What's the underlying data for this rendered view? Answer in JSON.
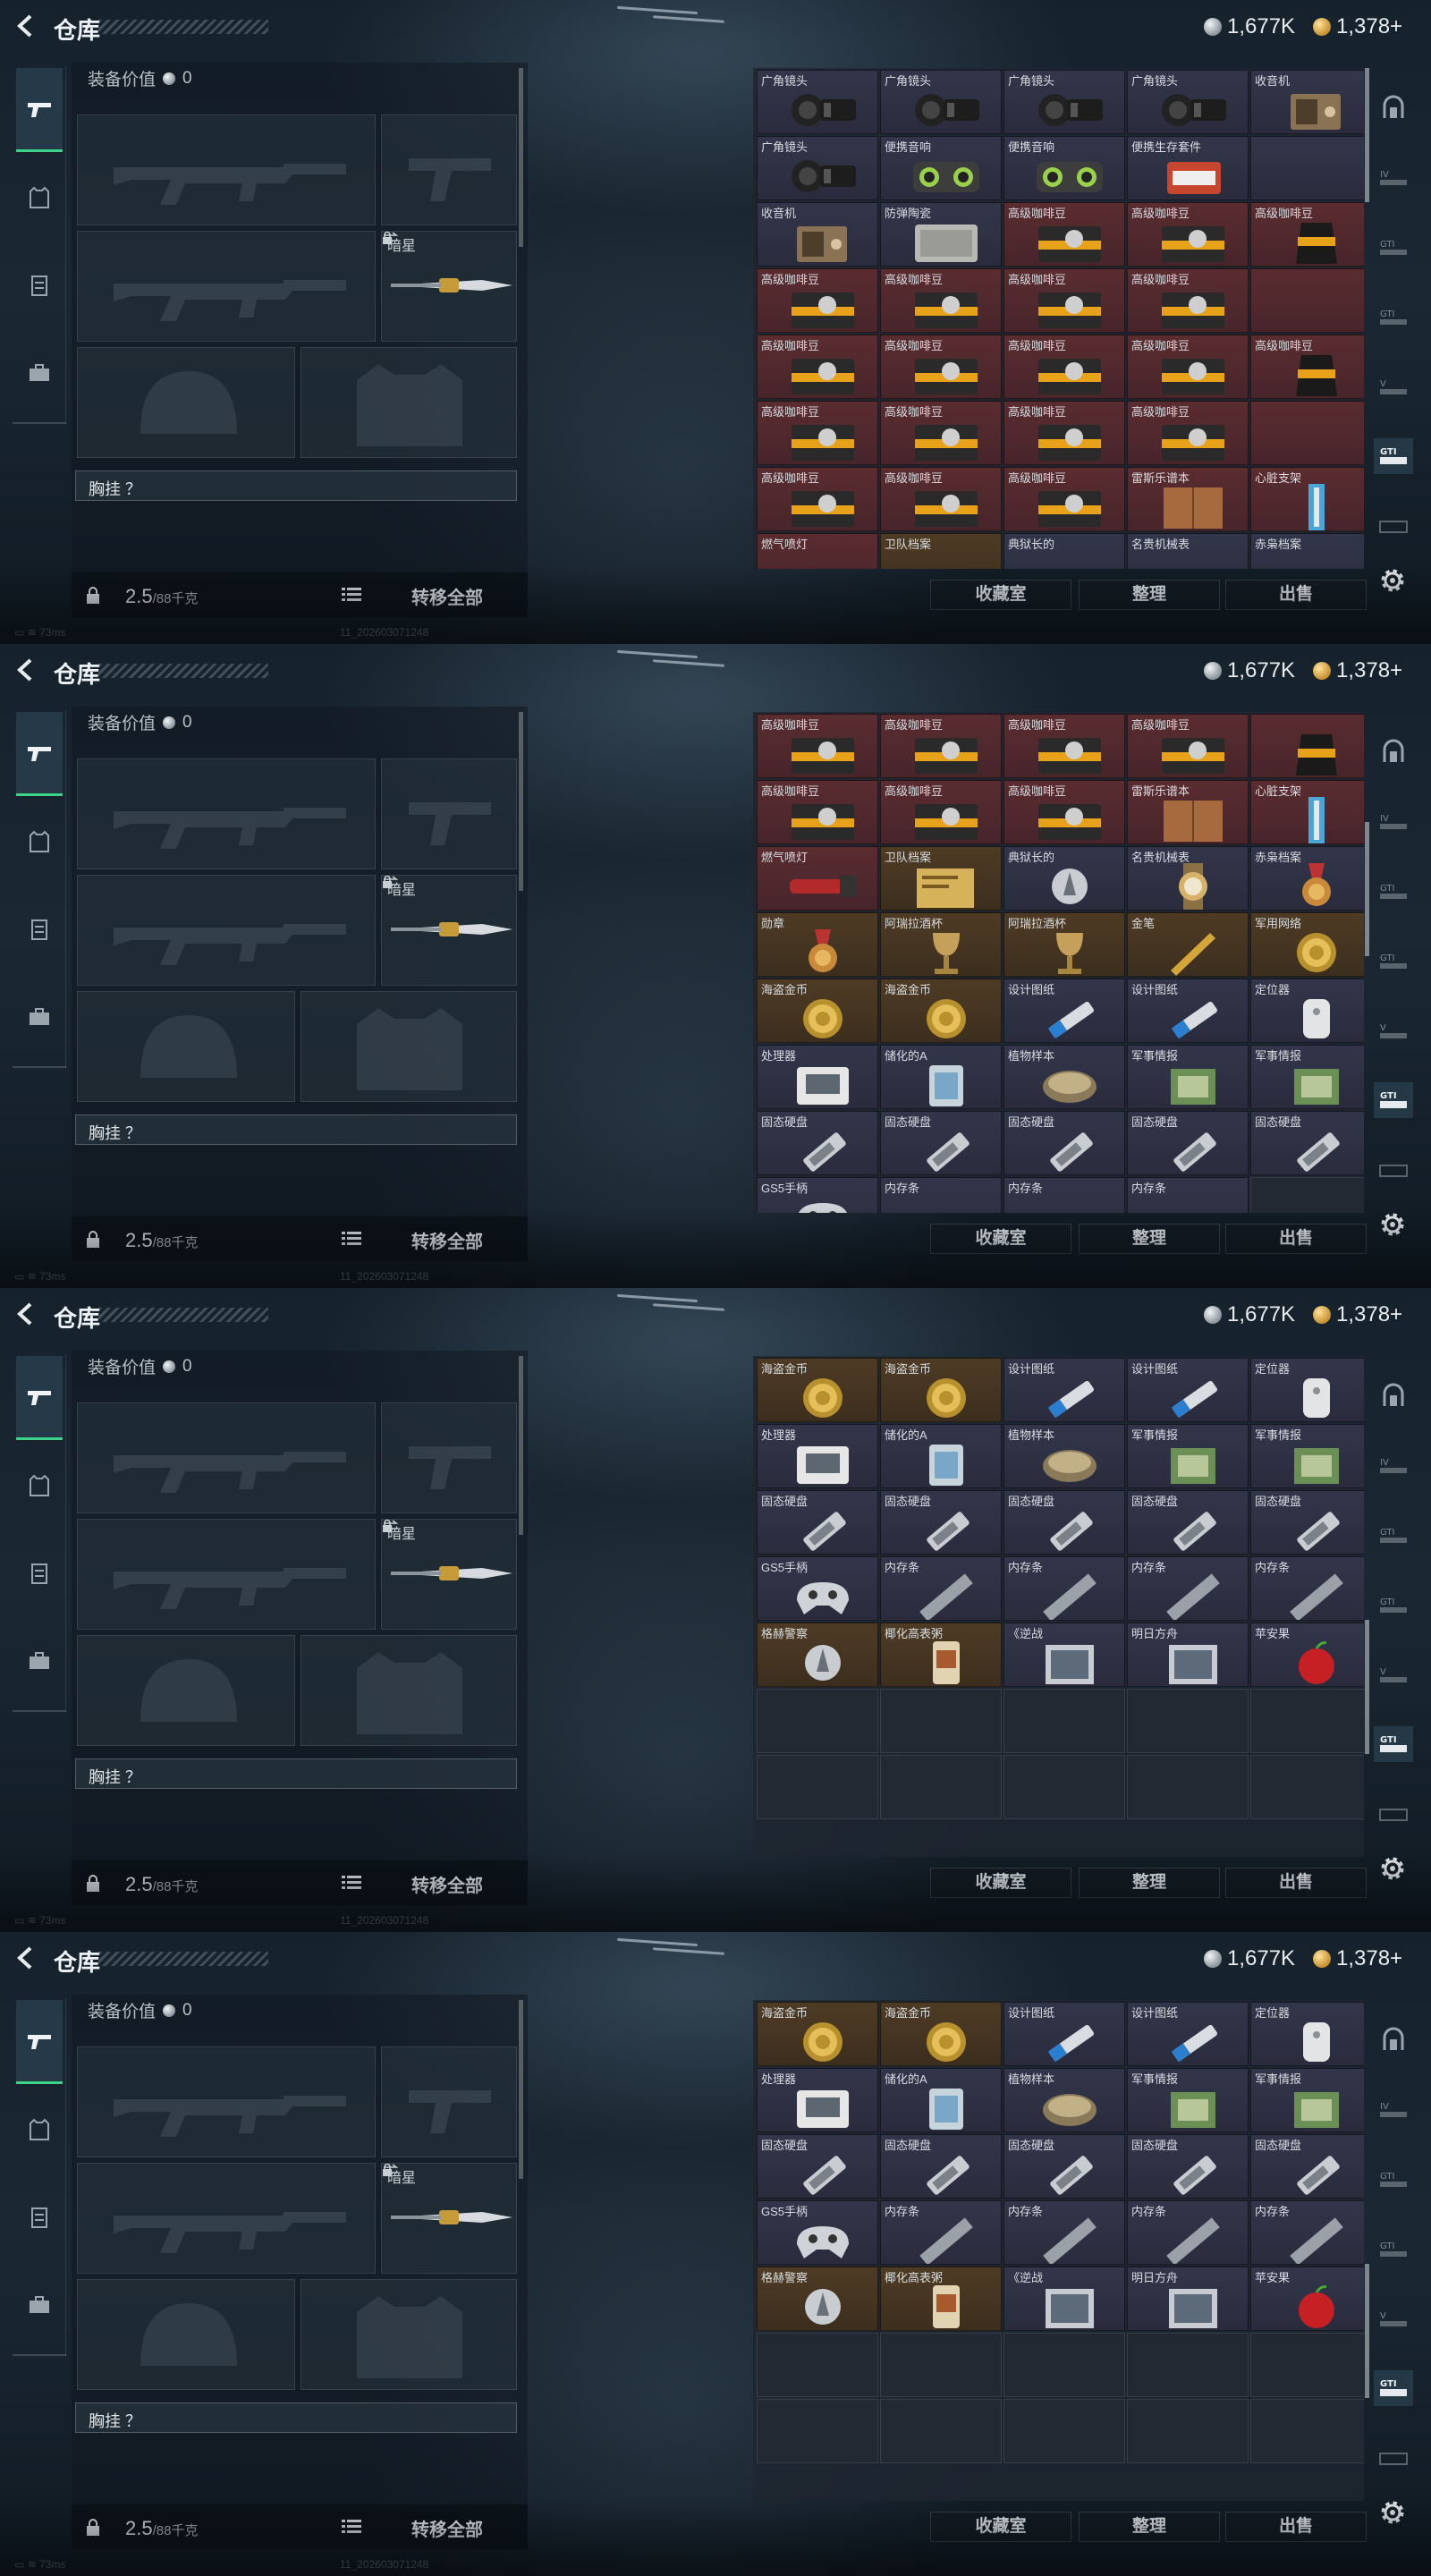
{
  "header": {
    "title": "仓库",
    "silver_amount": "1,677K",
    "gold_amount": "1,378+"
  },
  "equipment": {
    "value_label": "装备价值",
    "value": "0",
    "secondary_slot_label": "暗星",
    "chest_label": "胸挂 ？",
    "weight": "2.5",
    "capacity": "/88千克",
    "transfer_all": "转移全部"
  },
  "actions": {
    "collection": "收藏室",
    "sort": "整理",
    "sell": "出售"
  },
  "status": {
    "ping": "73ms",
    "build": "11_202603071248"
  },
  "colors": {
    "accent": "#40d38a",
    "red_rarity": "#5a2c30",
    "gold_rarity": "#4e3b24",
    "blue_rarity": "#33354a"
  },
  "frames": [
    {
      "scroll_fraction": 0.0,
      "rows": [
        [
          {
            "n": "广角镜头",
            "c": "blue",
            "i": "lens"
          },
          {
            "n": "广角镜头",
            "c": "blue",
            "i": "lens"
          },
          {
            "n": "广角镜头",
            "c": "blue",
            "i": "lens"
          },
          {
            "n": "广角镜头",
            "c": "blue",
            "i": "lens"
          },
          {
            "n": "收音机",
            "c": "blue",
            "i": "radio"
          }
        ],
        [
          {
            "n": "广角镜头",
            "c": "blue",
            "i": "lens"
          },
          {
            "n": "便携音响",
            "c": "blue",
            "i": "speaker"
          },
          {
            "n": "便携音响",
            "c": "blue",
            "i": "speaker"
          },
          {
            "n": "便携生存套件",
            "c": "blue",
            "i": "kit"
          },
          {
            "n": "",
            "c": "blue",
            "i": ""
          }
        ],
        [
          {
            "n": "收音机",
            "c": "blue",
            "i": "radio"
          },
          {
            "n": "防弹陶瓷",
            "c": "blue",
            "i": "plate"
          },
          {
            "n": "高级咖啡豆",
            "c": "red",
            "i": "coffee"
          },
          {
            "n": "高级咖啡豆",
            "c": "red",
            "i": "coffee"
          },
          {
            "n": "高级咖啡豆",
            "c": "red",
            "i": "bag"
          }
        ],
        [
          {
            "n": "高级咖啡豆",
            "c": "red",
            "i": "coffee"
          },
          {
            "n": "高级咖啡豆",
            "c": "red",
            "i": "coffee"
          },
          {
            "n": "高级咖啡豆",
            "c": "red",
            "i": "coffee"
          },
          {
            "n": "高级咖啡豆",
            "c": "red",
            "i": "coffee"
          },
          {
            "n": "",
            "c": "red",
            "i": ""
          }
        ],
        [
          {
            "n": "高级咖啡豆",
            "c": "red",
            "i": "coffee"
          },
          {
            "n": "高级咖啡豆",
            "c": "red",
            "i": "coffee"
          },
          {
            "n": "高级咖啡豆",
            "c": "red",
            "i": "coffee"
          },
          {
            "n": "高级咖啡豆",
            "c": "red",
            "i": "coffee"
          },
          {
            "n": "高级咖啡豆",
            "c": "red",
            "i": "bag"
          }
        ],
        [
          {
            "n": "高级咖啡豆",
            "c": "red",
            "i": "coffee"
          },
          {
            "n": "高级咖啡豆",
            "c": "red",
            "i": "coffee"
          },
          {
            "n": "高级咖啡豆",
            "c": "red",
            "i": "coffee"
          },
          {
            "n": "高级咖啡豆",
            "c": "red",
            "i": "coffee"
          },
          {
            "n": "",
            "c": "red",
            "i": ""
          }
        ],
        [
          {
            "n": "高级咖啡豆",
            "c": "red",
            "i": "coffee"
          },
          {
            "n": "高级咖啡豆",
            "c": "red",
            "i": "coffee"
          },
          {
            "n": "高级咖啡豆",
            "c": "red",
            "i": "coffee"
          },
          {
            "n": "雷斯乐谱本",
            "c": "red",
            "i": "book"
          },
          {
            "n": "心脏支架",
            "c": "red",
            "i": "stent"
          }
        ],
        [
          {
            "n": "燃气喷灯",
            "c": "red",
            "i": ""
          },
          {
            "n": "卫队档案",
            "c": "gold",
            "i": ""
          },
          {
            "n": "典狱长的",
            "c": "blue",
            "i": ""
          },
          {
            "n": "名贵机械表",
            "c": "blue",
            "i": ""
          },
          {
            "n": "赤枭档案",
            "c": "blue",
            "i": ""
          }
        ]
      ]
    },
    {
      "scroll_fraction": 0.3,
      "rows": [
        [
          {
            "n": "高级咖啡豆",
            "c": "red",
            "i": "coffee"
          },
          {
            "n": "高级咖啡豆",
            "c": "red",
            "i": "coffee"
          },
          {
            "n": "高级咖啡豆",
            "c": "red",
            "i": "coffee"
          },
          {
            "n": "高级咖啡豆",
            "c": "red",
            "i": "coffee"
          },
          {
            "n": "",
            "c": "red",
            "i": "bag"
          }
        ],
        [
          {
            "n": "高级咖啡豆",
            "c": "red",
            "i": "coffee"
          },
          {
            "n": "高级咖啡豆",
            "c": "red",
            "i": "coffee"
          },
          {
            "n": "高级咖啡豆",
            "c": "red",
            "i": "coffee"
          },
          {
            "n": "雷斯乐谱本",
            "c": "red",
            "i": "book"
          },
          {
            "n": "心脏支架",
            "c": "red",
            "i": "stent"
          }
        ],
        [
          {
            "n": "燃气喷灯",
            "c": "red",
            "i": "torch"
          },
          {
            "n": "卫队档案",
            "c": "gold",
            "i": "file"
          },
          {
            "n": "典狱长的",
            "c": "blue",
            "i": "tag"
          },
          {
            "n": "名贵机械表",
            "c": "blue",
            "i": "watch"
          },
          {
            "n": "赤枭档案",
            "c": "blue",
            "i": "medal"
          }
        ],
        [
          {
            "n": "勋章",
            "c": "gold",
            "i": "medal"
          },
          {
            "n": "阿瑞拉酒杯",
            "c": "gold",
            "i": "goblet"
          },
          {
            "n": "阿瑞拉酒杯",
            "c": "gold",
            "i": "goblet"
          },
          {
            "n": "金笔",
            "c": "gold",
            "i": "pen"
          },
          {
            "n": "军用网络",
            "c": "gold",
            "i": "coin"
          }
        ],
        [
          {
            "n": "海盗金币",
            "c": "gold",
            "i": "coin"
          },
          {
            "n": "海盗金币",
            "c": "gold",
            "i": "coin"
          },
          {
            "n": "设计图纸",
            "c": "blue",
            "i": "usb"
          },
          {
            "n": "设计图纸",
            "c": "blue",
            "i": "usb"
          },
          {
            "n": "定位器",
            "c": "blue",
            "i": "tracker"
          }
        ],
        [
          {
            "n": "处理器",
            "c": "blue",
            "i": "cpu"
          },
          {
            "n": "储化的A",
            "c": "blue",
            "i": "vial"
          },
          {
            "n": "植物样本",
            "c": "blue",
            "i": "dish"
          },
          {
            "n": "军事情报",
            "c": "blue",
            "i": "chip"
          },
          {
            "n": "军事情报",
            "c": "blue",
            "i": "chip"
          }
        ],
        [
          {
            "n": "固态硬盘",
            "c": "blue",
            "i": "ssd"
          },
          {
            "n": "固态硬盘",
            "c": "blue",
            "i": "ssd"
          },
          {
            "n": "固态硬盘",
            "c": "blue",
            "i": "ssd"
          },
          {
            "n": "固态硬盘",
            "c": "blue",
            "i": "ssd"
          },
          {
            "n": "固态硬盘",
            "c": "blue",
            "i": "ssd"
          }
        ],
        [
          {
            "n": "GS5手柄",
            "c": "blue",
            "i": "pad"
          },
          {
            "n": "内存条",
            "c": "blue",
            "i": ""
          },
          {
            "n": "内存条",
            "c": "blue",
            "i": ""
          },
          {
            "n": "内存条",
            "c": "blue",
            "i": ""
          },
          {
            "n": "",
            "c": "empty",
            "i": ""
          }
        ]
      ]
    },
    {
      "scroll_fraction": 0.72,
      "rows": [
        [
          {
            "n": "海盗金币",
            "c": "gold",
            "i": "coin"
          },
          {
            "n": "海盗金币",
            "c": "gold",
            "i": "coin"
          },
          {
            "n": "设计图纸",
            "c": "blue",
            "i": "usb"
          },
          {
            "n": "设计图纸",
            "c": "blue",
            "i": "usb"
          },
          {
            "n": "定位器",
            "c": "blue",
            "i": "tracker"
          }
        ],
        [
          {
            "n": "处理器",
            "c": "blue",
            "i": "cpu"
          },
          {
            "n": "储化的A",
            "c": "blue",
            "i": "vial"
          },
          {
            "n": "植物样本",
            "c": "blue",
            "i": "dish"
          },
          {
            "n": "军事情报",
            "c": "blue",
            "i": "chip"
          },
          {
            "n": "军事情报",
            "c": "blue",
            "i": "chip"
          }
        ],
        [
          {
            "n": "固态硬盘",
            "c": "blue",
            "i": "ssd"
          },
          {
            "n": "固态硬盘",
            "c": "blue",
            "i": "ssd"
          },
          {
            "n": "固态硬盘",
            "c": "blue",
            "i": "ssd"
          },
          {
            "n": "固态硬盘",
            "c": "blue",
            "i": "ssd"
          },
          {
            "n": "固态硬盘",
            "c": "blue",
            "i": "ssd"
          }
        ],
        [
          {
            "n": "GS5手柄",
            "c": "blue",
            "i": "pad"
          },
          {
            "n": "内存条",
            "c": "blue",
            "i": "ram"
          },
          {
            "n": "内存条",
            "c": "blue",
            "i": "ram"
          },
          {
            "n": "内存条",
            "c": "blue",
            "i": "ram"
          },
          {
            "n": "内存条",
            "c": "blue",
            "i": "ram"
          }
        ],
        [
          {
            "n": "格赫警察",
            "c": "gold",
            "i": "tag"
          },
          {
            "n": "椰化高表粥",
            "c": "gold",
            "i": "can"
          },
          {
            "n": "《逆战",
            "c": "blue",
            "i": "disc"
          },
          {
            "n": "明日方舟",
            "c": "blue",
            "i": "disc"
          },
          {
            "n": "苹安果",
            "c": "blue",
            "i": "apple"
          }
        ],
        [
          {
            "n": "",
            "c": "empty",
            "i": ""
          },
          {
            "n": "",
            "c": "empty",
            "i": ""
          },
          {
            "n": "",
            "c": "empty",
            "i": ""
          },
          {
            "n": "",
            "c": "empty",
            "i": ""
          },
          {
            "n": "",
            "c": "empty",
            "i": ""
          }
        ],
        [
          {
            "n": "",
            "c": "empty",
            "i": ""
          },
          {
            "n": "",
            "c": "empty",
            "i": ""
          },
          {
            "n": "",
            "c": "empty",
            "i": ""
          },
          {
            "n": "",
            "c": "empty",
            "i": ""
          },
          {
            "n": "",
            "c": "empty",
            "i": ""
          }
        ]
      ]
    },
    {
      "scroll_fraction": 0.72,
      "rows": [
        [
          {
            "n": "海盗金币",
            "c": "gold",
            "i": "coin"
          },
          {
            "n": "海盗金币",
            "c": "gold",
            "i": "coin"
          },
          {
            "n": "设计图纸",
            "c": "blue",
            "i": "usb"
          },
          {
            "n": "设计图纸",
            "c": "blue",
            "i": "usb"
          },
          {
            "n": "定位器",
            "c": "blue",
            "i": "tracker"
          }
        ],
        [
          {
            "n": "处理器",
            "c": "blue",
            "i": "cpu"
          },
          {
            "n": "储化的A",
            "c": "blue",
            "i": "vial"
          },
          {
            "n": "植物样本",
            "c": "blue",
            "i": "dish"
          },
          {
            "n": "军事情报",
            "c": "blue",
            "i": "chip"
          },
          {
            "n": "军事情报",
            "c": "blue",
            "i": "chip"
          }
        ],
        [
          {
            "n": "固态硬盘",
            "c": "blue",
            "i": "ssd"
          },
          {
            "n": "固态硬盘",
            "c": "blue",
            "i": "ssd"
          },
          {
            "n": "固态硬盘",
            "c": "blue",
            "i": "ssd"
          },
          {
            "n": "固态硬盘",
            "c": "blue",
            "i": "ssd"
          },
          {
            "n": "固态硬盘",
            "c": "blue",
            "i": "ssd"
          }
        ],
        [
          {
            "n": "GS5手柄",
            "c": "blue",
            "i": "pad"
          },
          {
            "n": "内存条",
            "c": "blue",
            "i": "ram"
          },
          {
            "n": "内存条",
            "c": "blue",
            "i": "ram"
          },
          {
            "n": "内存条",
            "c": "blue",
            "i": "ram"
          },
          {
            "n": "内存条",
            "c": "blue",
            "i": "ram"
          }
        ],
        [
          {
            "n": "格赫警察",
            "c": "gold",
            "i": "tag"
          },
          {
            "n": "椰化高表粥",
            "c": "gold",
            "i": "can"
          },
          {
            "n": "《逆战",
            "c": "blue",
            "i": "disc"
          },
          {
            "n": "明日方舟",
            "c": "blue",
            "i": "disc"
          },
          {
            "n": "苹安果",
            "c": "blue",
            "i": "apple"
          }
        ],
        [
          {
            "n": "",
            "c": "empty",
            "i": ""
          },
          {
            "n": "",
            "c": "empty",
            "i": ""
          },
          {
            "n": "",
            "c": "empty",
            "i": ""
          },
          {
            "n": "",
            "c": "empty",
            "i": ""
          },
          {
            "n": "",
            "c": "empty",
            "i": ""
          }
        ],
        [
          {
            "n": "",
            "c": "empty",
            "i": ""
          },
          {
            "n": "",
            "c": "empty",
            "i": ""
          },
          {
            "n": "",
            "c": "empty",
            "i": ""
          },
          {
            "n": "",
            "c": "empty",
            "i": ""
          },
          {
            "n": "",
            "c": "empty",
            "i": ""
          }
        ]
      ]
    }
  ]
}
